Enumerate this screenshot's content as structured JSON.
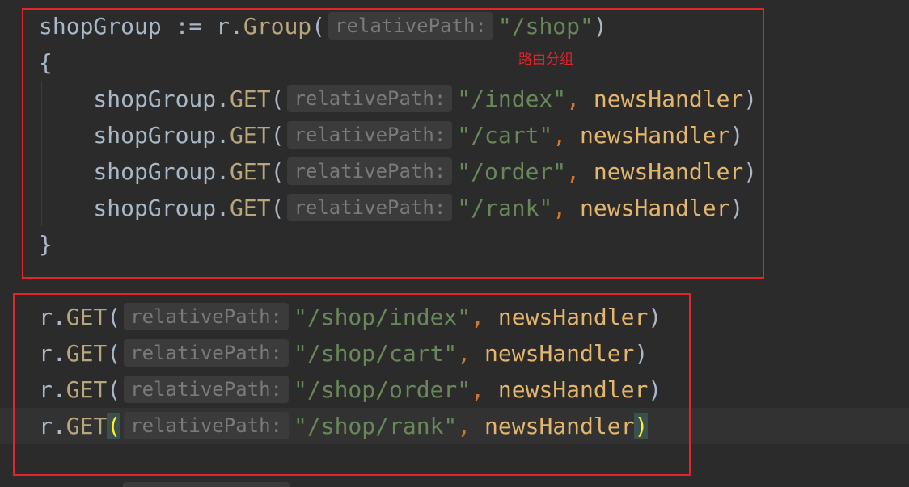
{
  "editor": {
    "colors": {
      "background": "#2b2b2b",
      "text": "#a9b7c6",
      "method": "#b9a77c",
      "handler": "#e3b56d",
      "string": "#6a8759",
      "comma": "#cc7832",
      "hint_text": "#7a7a7a",
      "hint_background": "#3b3b3b",
      "current_line": "#323232",
      "brace_match_background": "#3b514d",
      "brace_match_text": "#ffef28",
      "annotation": "#e0262c",
      "indent_guide": "#3d3d3d"
    },
    "syntax": {
      "assign": ":=",
      "dot": ".",
      "paren_open": "(",
      "paren_close": ")",
      "comma": ",",
      "brace_open": "{",
      "brace_close": "}"
    },
    "inlay_hint": "relativePath:",
    "annotation_label": "路由分组",
    "group_block": {
      "declaration": {
        "variable": "shopGroup",
        "receiver": "r",
        "method": "Group",
        "path": "\"/shop\""
      },
      "routes": [
        {
          "receiver": "shopGroup",
          "method": "GET",
          "path": "\"/index\"",
          "handler": "newsHandler"
        },
        {
          "receiver": "shopGroup",
          "method": "GET",
          "path": "\"/cart\"",
          "handler": "newsHandler"
        },
        {
          "receiver": "shopGroup",
          "method": "GET",
          "path": "\"/order\"",
          "handler": "newsHandler"
        },
        {
          "receiver": "shopGroup",
          "method": "GET",
          "path": "\"/rank\"",
          "handler": "newsHandler"
        }
      ]
    },
    "flat_block": {
      "routes": [
        {
          "receiver": "r",
          "method": "GET",
          "path": "\"/shop/index\"",
          "handler": "newsHandler"
        },
        {
          "receiver": "r",
          "method": "GET",
          "path": "\"/shop/cart\"",
          "handler": "newsHandler"
        },
        {
          "receiver": "r",
          "method": "GET",
          "path": "\"/shop/order\"",
          "handler": "newsHandler"
        },
        {
          "receiver": "r",
          "method": "GET",
          "path": "\"/shop/rank\"",
          "handler": "newsHandler"
        }
      ]
    }
  }
}
